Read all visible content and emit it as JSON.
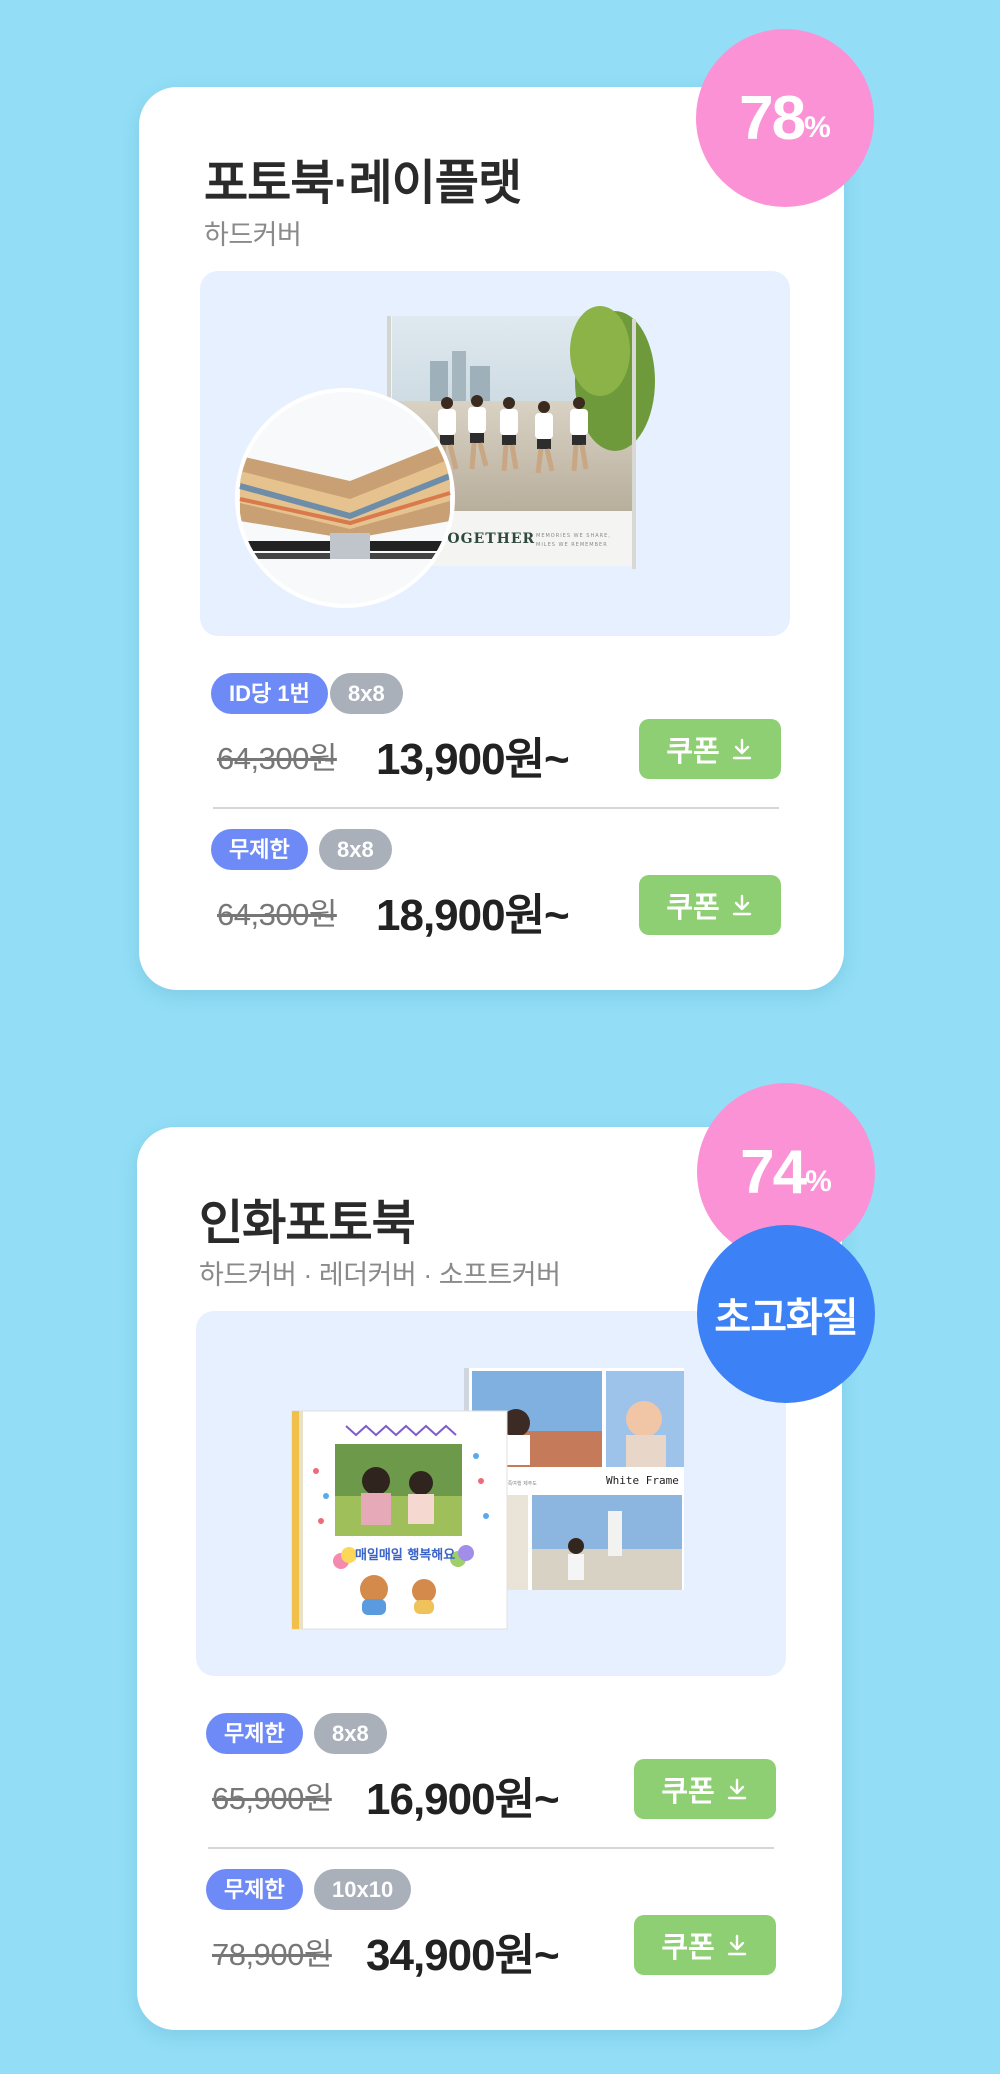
{
  "products": [
    {
      "title": "포토북·레이플랫",
      "subtitle": "하드커버",
      "discount_number": "78",
      "discount_unit": "%",
      "photo_text": "TOGETHER",
      "photo_caption": "MEMORIES WE SHARE, MILES WE REMEMBER",
      "options": [
        {
          "badge1": "ID당 1번",
          "badge2": "8x8",
          "old_price": "64,300원",
          "new_price": "13,900원~",
          "coupon_label": "쿠폰"
        },
        {
          "badge1": "무제한",
          "badge2": "8x8",
          "old_price": "64,300원",
          "new_price": "18,900원~",
          "coupon_label": "쿠폰"
        }
      ]
    },
    {
      "title": "인화포토북",
      "subtitle": "하드커버 · 레더커버 · 소프트커버",
      "discount_number": "74",
      "discount_unit": "%",
      "quality_label": "초고화질",
      "book_text": "매일매일 행복해요",
      "frame_label": "White Frame",
      "options": [
        {
          "badge1": "무제한",
          "badge2": "8x8",
          "old_price": "65,900원",
          "new_price": "16,900원~",
          "coupon_label": "쿠폰"
        },
        {
          "badge1": "무제한",
          "badge2": "10x10",
          "old_price": "78,900원",
          "new_price": "34,900원~",
          "coupon_label": "쿠폰"
        }
      ]
    }
  ],
  "colors": {
    "background": "#93def6",
    "discount_pink": "#fb92d6",
    "quality_blue": "#3c81f6",
    "coupon_green": "#8fcf74",
    "badge_blue": "#6e8af7",
    "badge_gray": "#a9b0b9"
  },
  "icons": {
    "coupon": "download-arrow-icon"
  }
}
